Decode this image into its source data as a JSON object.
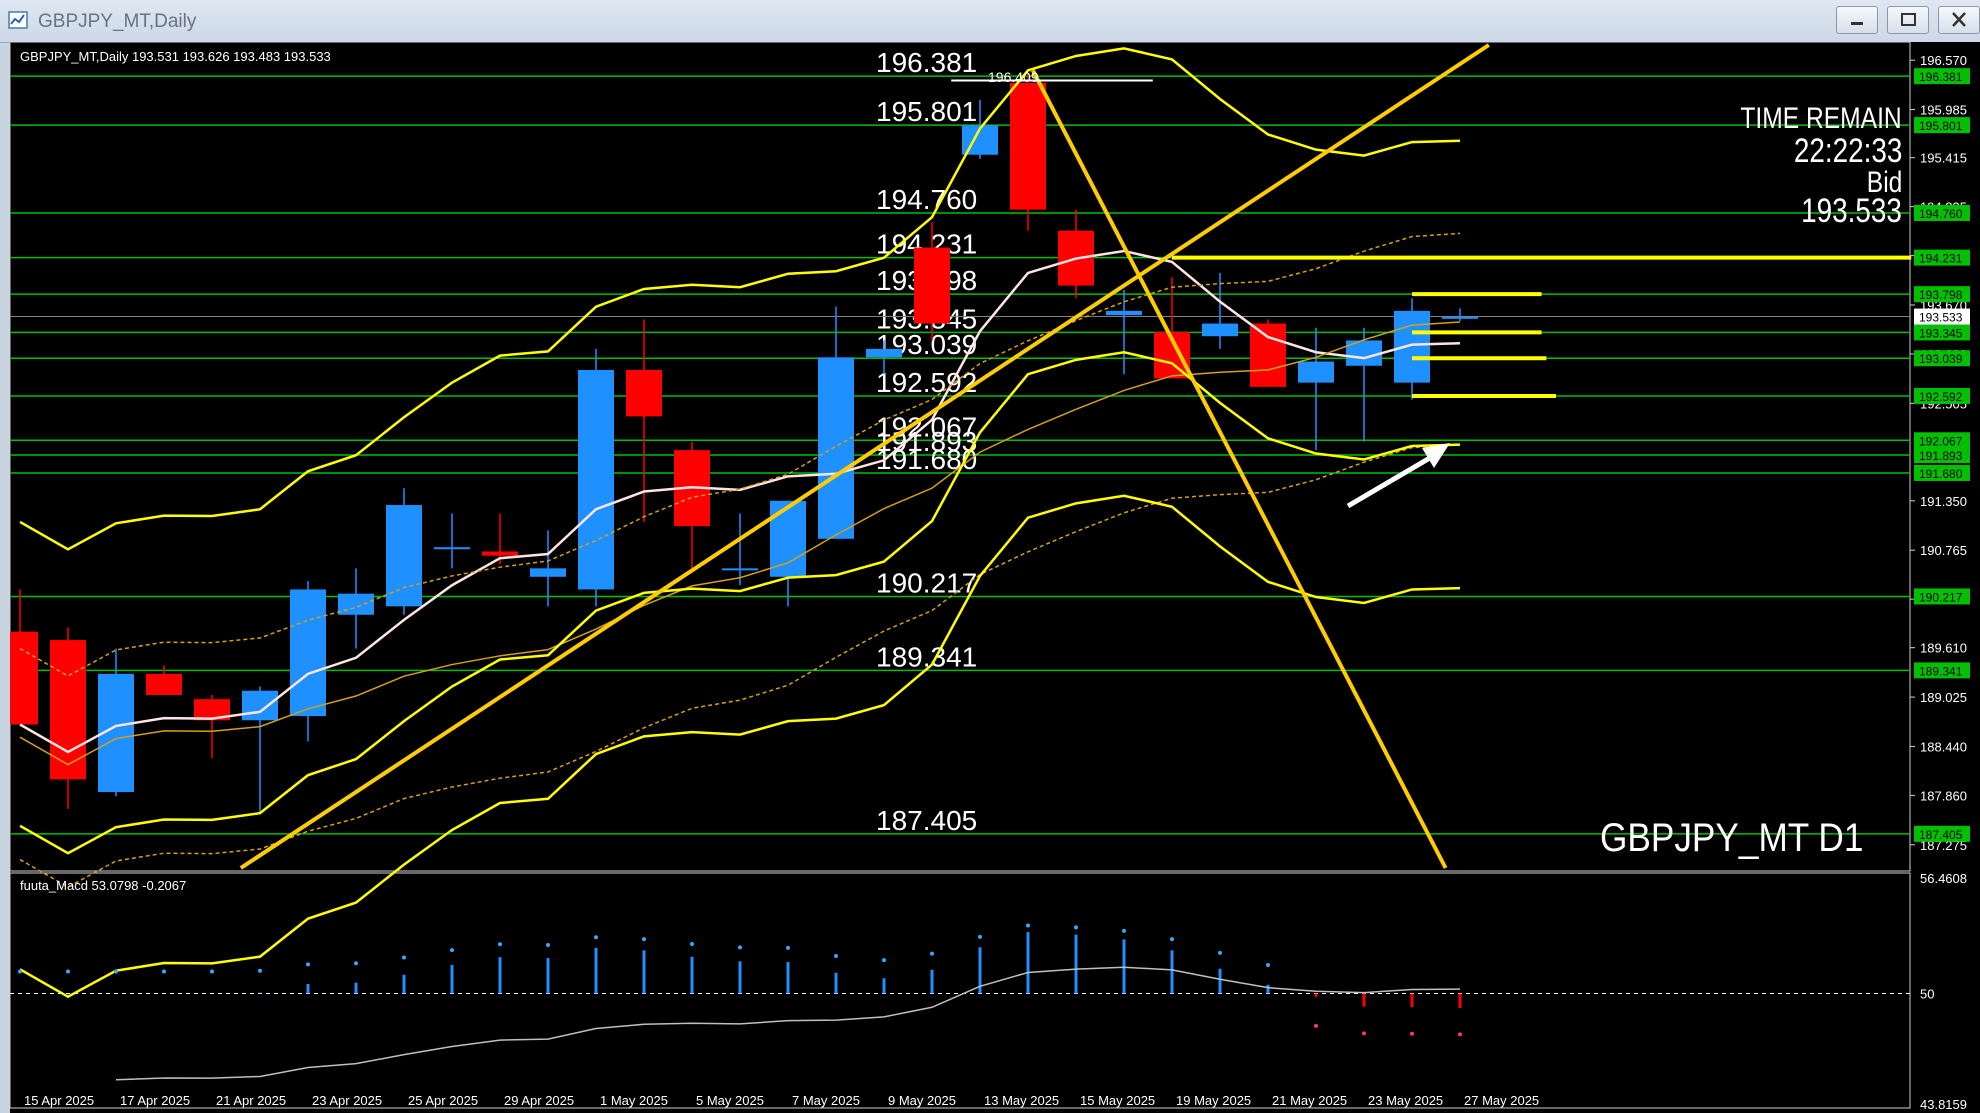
{
  "window": {
    "title": "GBPJPY_MT,Daily"
  },
  "chart_info": "GBPJPY_MT,Daily  193.531 193.626 193.483 193.533",
  "indicator_info": "fuuta_Macd 53.0798   -0.2067",
  "overlay": {
    "time_label": "TIME REMAIN",
    "time_value": "22:22:33",
    "bid_label": "Bid",
    "bid_value": "193.533",
    "symbol": "GBPJPY_MT D1"
  },
  "colors": {
    "background": "#000000",
    "bull": "#1e90ff",
    "bear": "#ff0000",
    "level_line": "#00c000",
    "trend_line": "#ffcc00",
    "band_line": "#ffff00",
    "ma_line": "#ffe4e1",
    "arrow": "#ffffff"
  },
  "chart_data": [
    {
      "type": "candlestick",
      "ylim": [
        187.0,
        196.75
      ],
      "y_ticks": [
        "196.570",
        "195.985",
        "195.415",
        "194.835",
        "194.255",
        "193.670",
        "193.090",
        "192.505",
        "191.350",
        "190.765",
        "190.185",
        "189.610",
        "189.025",
        "188.440",
        "187.860",
        "187.275"
      ],
      "x_labels": [
        "15 Apr 2025",
        "17 Apr 2025",
        "21 Apr 2025",
        "23 Apr 2025",
        "25 Apr 2025",
        "29 Apr 2025",
        "1 May 2025",
        "5 May 2025",
        "7 May 2025",
        "9 May 2025",
        "13 May 2025",
        "15 May 2025",
        "19 May 2025",
        "21 May 2025",
        "23 May 2025",
        "27 May 2025"
      ],
      "levels": [
        196.381,
        195.801,
        194.76,
        194.231,
        193.798,
        193.345,
        193.039,
        192.592,
        192.067,
        191.893,
        191.68,
        190.217,
        189.341,
        187.405
      ],
      "level_tags": [
        "196.381",
        "195.801",
        "194.760",
        "194.231",
        "193.798",
        "193.345",
        "193.039",
        "192.592",
        "192.067",
        "191.893",
        "191.680",
        "190.217",
        "189.341",
        "187.405"
      ],
      "high_label": "196.409",
      "current_price": "193.533",
      "candles": [
        [
          189.8,
          190.3,
          188.8,
          188.7
        ],
        [
          189.7,
          189.85,
          187.7,
          188.05
        ],
        [
          187.9,
          189.6,
          187.85,
          189.3
        ],
        [
          189.3,
          189.4,
          189.05,
          189.05
        ],
        [
          189.0,
          189.05,
          188.3,
          188.75
        ],
        [
          188.75,
          189.15,
          187.65,
          189.1
        ],
        [
          188.8,
          190.4,
          188.5,
          190.3
        ],
        [
          190.0,
          190.55,
          189.6,
          190.25
        ],
        [
          190.1,
          191.5,
          190.0,
          191.3
        ],
        [
          190.8,
          191.2,
          190.55,
          190.8
        ],
        [
          190.75,
          191.2,
          190.6,
          190.7
        ],
        [
          190.45,
          191.0,
          190.1,
          190.55
        ],
        [
          190.3,
          193.15,
          190.1,
          192.9
        ],
        [
          192.9,
          193.5,
          191.1,
          192.35
        ],
        [
          191.95,
          192.05,
          190.55,
          191.05
        ],
        [
          190.55,
          191.2,
          190.35,
          190.55
        ],
        [
          190.45,
          191.35,
          190.1,
          191.35
        ],
        [
          190.9,
          193.65,
          190.9,
          193.05
        ],
        [
          193.05,
          193.25,
          192.85,
          193.15
        ],
        [
          194.35,
          194.65,
          193.25,
          193.45
        ],
        [
          195.45,
          196.1,
          195.4,
          195.8
        ],
        [
          196.3,
          196.41,
          194.55,
          194.8
        ],
        [
          194.55,
          194.8,
          193.75,
          193.9
        ],
        [
          193.55,
          193.85,
          192.85,
          193.6
        ],
        [
          193.35,
          194.0,
          192.8,
          192.8
        ],
        [
          193.3,
          194.05,
          193.15,
          193.45
        ],
        [
          193.45,
          193.5,
          192.7,
          192.7
        ],
        [
          192.75,
          193.4,
          191.95,
          193.0
        ],
        [
          192.95,
          193.4,
          192.05,
          193.25
        ],
        [
          192.75,
          193.75,
          192.55,
          193.6
        ],
        [
          193.53,
          193.63,
          193.48,
          193.53
        ]
      ],
      "macd": {
        "ylim": [
          43.8159,
          56.4608
        ],
        "y_ticks": [
          "56.4608",
          "50",
          "43.8159"
        ],
        "value": "53.0798",
        "signal": "-0.2067"
      }
    }
  ]
}
